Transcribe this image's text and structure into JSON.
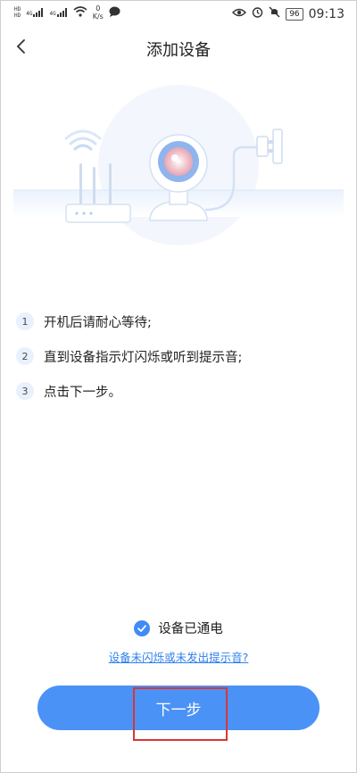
{
  "status_bar": {
    "sim_tags": [
      "HD",
      "HD"
    ],
    "signal_labels": [
      "4G",
      "4G"
    ],
    "net_speed_value": "0",
    "net_speed_unit": "K/s",
    "battery": "96",
    "time": "09:13"
  },
  "header": {
    "title": "添加设备"
  },
  "steps": [
    {
      "num": "1",
      "text": "开机后请耐心等待;"
    },
    {
      "num": "2",
      "text": "直到设备指示灯闪烁或听到提示音;"
    },
    {
      "num": "3",
      "text": "点击下一步。"
    }
  ],
  "confirm": {
    "label": "设备已通电",
    "checked": true
  },
  "help_link": "设备未闪烁或未发出提示音?",
  "next_button": "下一步",
  "colors": {
    "accent": "#4a92f6",
    "link": "#2f80ed",
    "highlight": "#d93636"
  }
}
